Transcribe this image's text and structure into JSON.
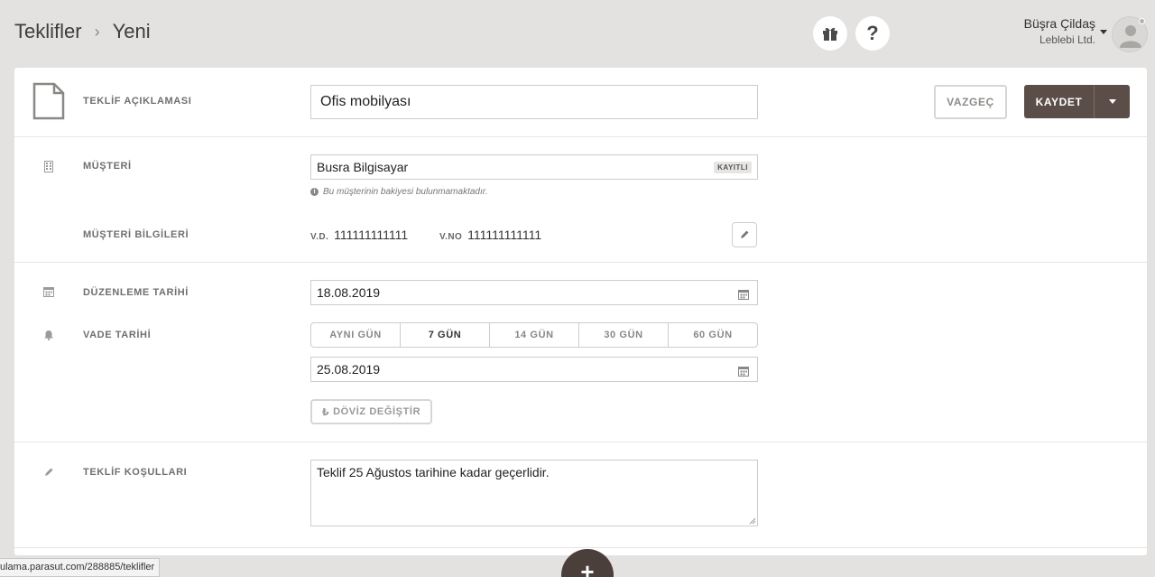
{
  "breadcrumb": {
    "parent": "Teklifler",
    "separator": "›",
    "current": "Yeni"
  },
  "header_icons": {
    "gift": "gift-icon",
    "help": "?"
  },
  "user": {
    "name": "Büşra Çildaş",
    "company": "Leblebi Ltd."
  },
  "description": {
    "label": "TEKLİF AÇIKLAMASI",
    "value": "Ofis mobilyası"
  },
  "actions": {
    "cancel": "VAZGEÇ",
    "save": "KAYDET"
  },
  "customer": {
    "label": "MÜŞTERİ",
    "value": "Busra Bilgisayar",
    "badge": "KAYITLI",
    "hint": "Bu müşterinin bakiyesi bulunmamaktadır."
  },
  "customer_info": {
    "label": "MÜŞTERİ BİLGİLERİ",
    "vd_key": "V.D.",
    "vd_value": "111111111111",
    "vno_key": "V.NO",
    "vno_value": "111111111111"
  },
  "issue_date": {
    "label": "DÜZENLEME TARİHİ",
    "value": "18.08.2019"
  },
  "due_date": {
    "label": "VADE TARİHİ",
    "options": [
      "AYNI GÜN",
      "7 GÜN",
      "14 GÜN",
      "30 GÜN",
      "60 GÜN"
    ],
    "selected": "7 GÜN",
    "value": "25.08.2019"
  },
  "currency": {
    "symbol": "₺",
    "label": "DÖVİZ DEĞİŞTİR"
  },
  "terms": {
    "label": "TEKLİF KOŞULLARI",
    "value": "Teklif 25 Ağustos tarihine kadar geçerlidir."
  },
  "status_url": "ulama.parasut.com/288885/teklifler",
  "fab": "+"
}
